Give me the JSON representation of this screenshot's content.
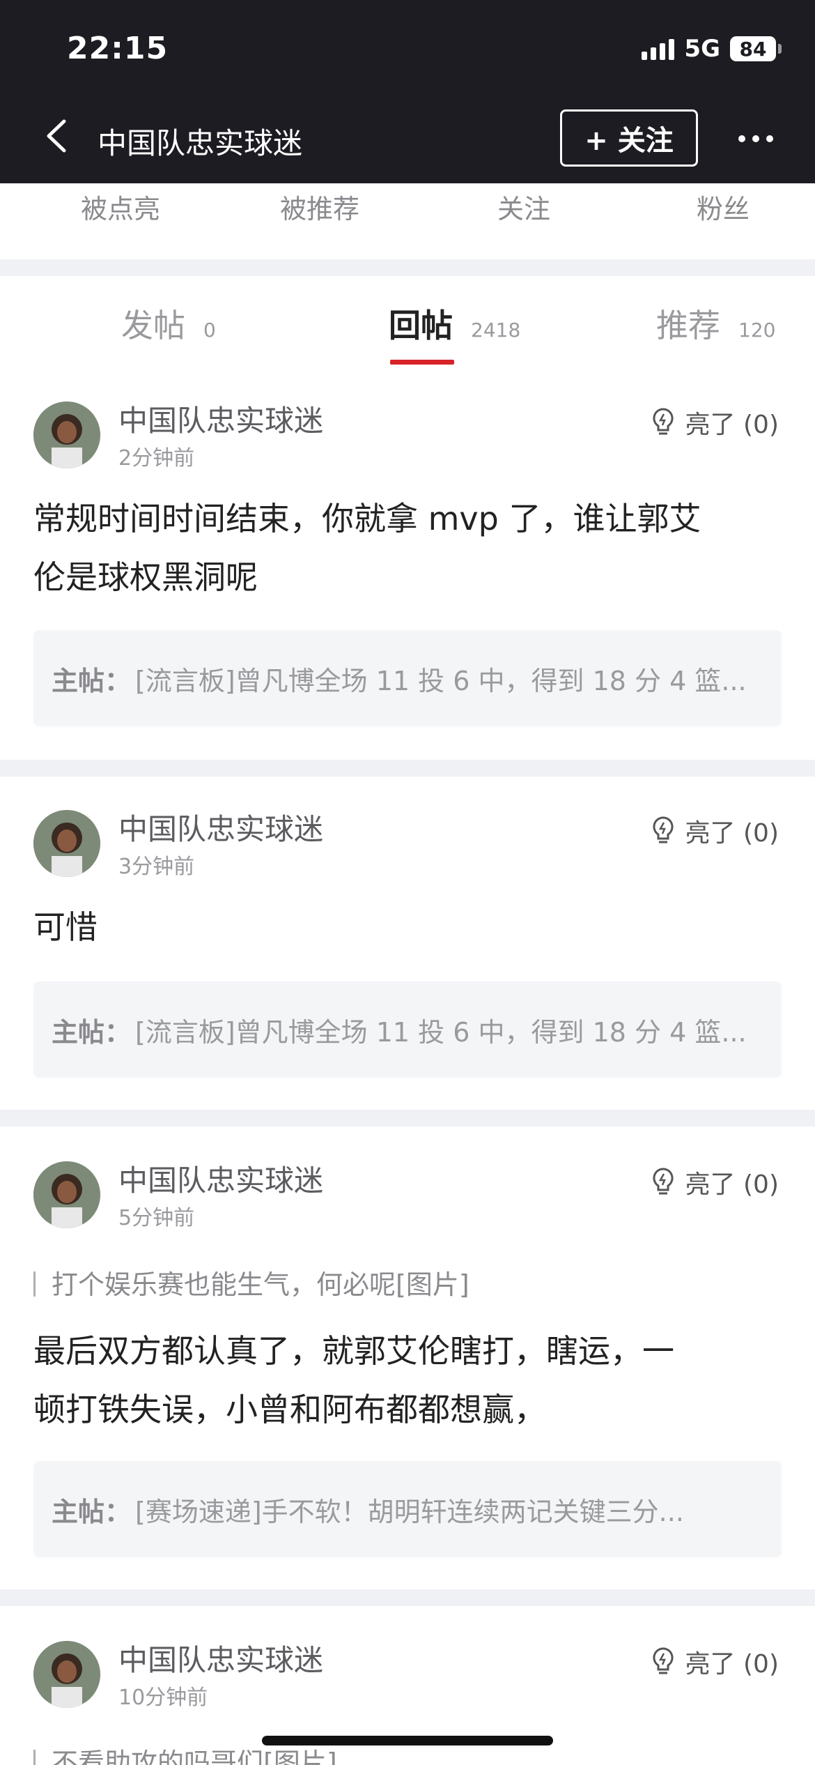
{
  "status_bar": {
    "time": "22:15",
    "network": "5G",
    "battery": "84"
  },
  "header": {
    "title": "中国队忠实球迷",
    "follow_label": "+ 关注"
  },
  "stats": [
    "被点亮",
    "被推荐",
    "关注",
    "粉丝"
  ],
  "tabs": [
    {
      "label": "发帖",
      "count": "0"
    },
    {
      "label": "回帖",
      "count": "2418"
    },
    {
      "label": "推荐",
      "count": "120"
    }
  ],
  "posts": [
    {
      "username": "中国队忠实球迷",
      "time": "2分钟前",
      "likes": "亮了 (0)",
      "quote": "",
      "lines": [
        "常规时间时间结束，你就拿 mvp 了，谁让郭艾",
        "伦是球权黑洞呢"
      ],
      "parent_label": "主帖：",
      "parent": "[流言板]曾凡博全场 11 投 6 中，得到 18 分 4 篮..."
    },
    {
      "username": "中国队忠实球迷",
      "time": "3分钟前",
      "likes": "亮了 (0)",
      "quote": "",
      "lines": [
        "可惜"
      ],
      "parent_label": "主帖：",
      "parent": "[流言板]曾凡博全场 11 投 6 中，得到 18 分 4 篮..."
    },
    {
      "username": "中国队忠实球迷",
      "time": "5分钟前",
      "likes": "亮了 (0)",
      "quote": "打个娱乐赛也能生气，何必呢[图片]",
      "lines": [
        "最后双方都认真了，就郭艾伦瞎打，瞎运，一",
        "顿打铁失误，小曾和阿布都都想赢，"
      ],
      "parent_label": "主帖：",
      "parent": "[赛场速递]手不软！胡明轩连续两记关键三分..."
    },
    {
      "username": "中国队忠实球迷",
      "time": "10分钟前",
      "likes": "亮了 (0)",
      "quote": "不看助攻的吗哥们[图片]",
      "lines": [],
      "parent_label": "",
      "parent": ""
    }
  ]
}
